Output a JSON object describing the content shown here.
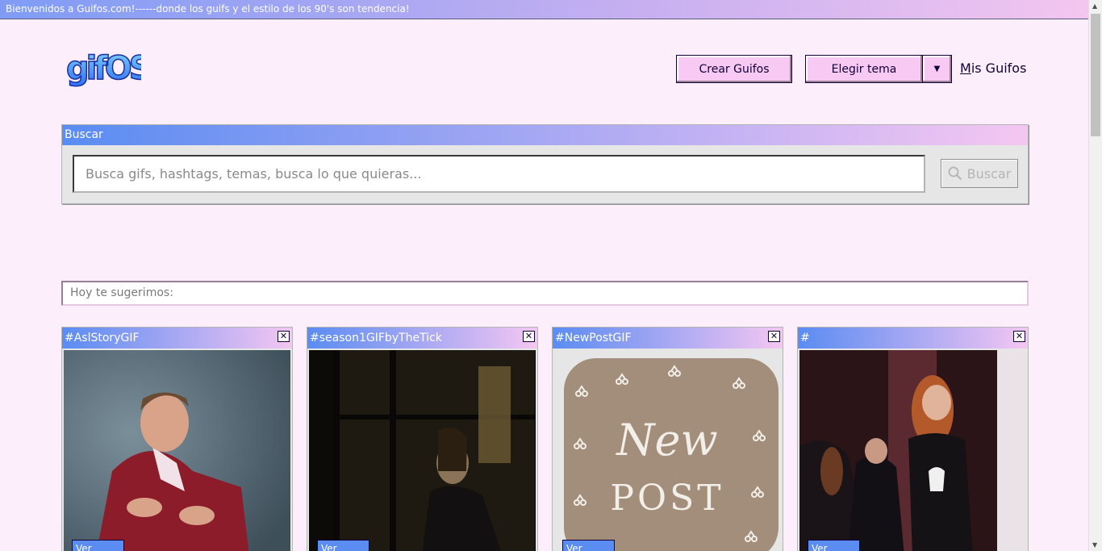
{
  "topbar": {
    "text": "Bienvenidos a Guifos.com!------donde los guifs y el estilo de los 90's son tendencia!"
  },
  "logo": {
    "text": "gifOS"
  },
  "header": {
    "create_label": "Crear Guifos",
    "theme_label": "Elegir tema",
    "mis_guifos_first": "M",
    "mis_guifos_rest": "is Guifos"
  },
  "search": {
    "header": "Buscar",
    "placeholder": "Busca gifs, hashtags, temas, busca lo que quieras...",
    "button_label": "Buscar"
  },
  "suggest": {
    "label": "Hoy te sugerimos:"
  },
  "cards": [
    {
      "tag": "#AslStoryGIF",
      "more": "Ver más..."
    },
    {
      "tag": "#season1GIFbyTheTick",
      "more": "Ver más..."
    },
    {
      "tag": "#NewPostGIF",
      "more": "Ver más...",
      "art_line1": "New",
      "art_line2": "POST"
    },
    {
      "tag": "#",
      "more": "Ver más..."
    }
  ],
  "colors": {
    "background": "#fdeefb",
    "button_pink": "#f7c9f3",
    "accent_blue": "#5a8cf2",
    "text_dark": "#110038"
  }
}
